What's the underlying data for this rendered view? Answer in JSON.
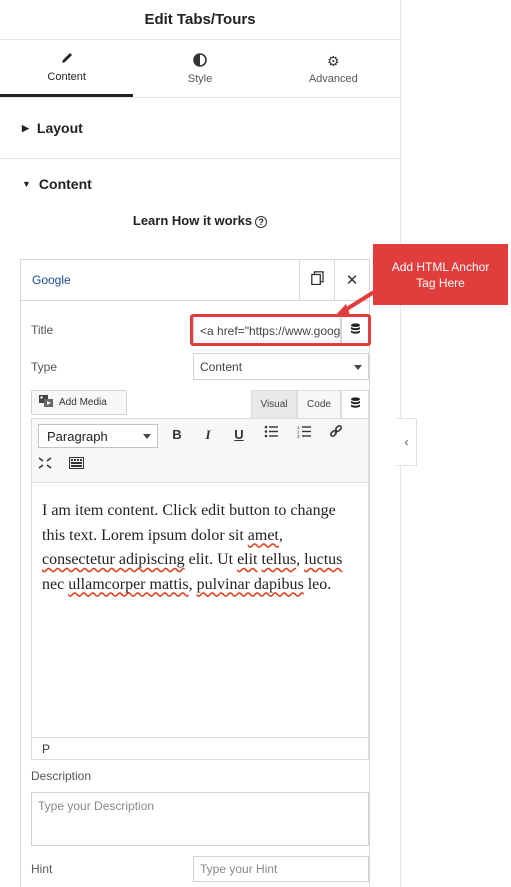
{
  "header": {
    "title": "Edit Tabs/Tours"
  },
  "tabs": [
    {
      "label": "Content",
      "icon": "pencil-icon",
      "active": true
    },
    {
      "label": "Style",
      "icon": "contrast-icon",
      "active": false
    },
    {
      "label": "Advanced",
      "icon": "gear-icon",
      "active": false
    }
  ],
  "sections": {
    "layout": "Layout",
    "content": "Content"
  },
  "learn": {
    "label": "Learn How it works"
  },
  "item": {
    "title": "Google",
    "fields": {
      "title_label": "Title",
      "title_value": "<a href=\"https://www.goog",
      "type_label": "Type",
      "type_value": "Content",
      "add_media": "Add Media",
      "visual_tab": "Visual",
      "code_tab": "Code",
      "format_value": "Paragraph",
      "content_p1": "I am item content. Click edit button to change this text. Lorem ipsum dolor sit ",
      "content_sq1": "amet",
      "content_p2": ", ",
      "content_sq2": "consectetur adipiscing",
      "content_p3": " elit. Ut ",
      "content_sq3": "elit",
      "content_sq4": "tellus",
      "content_p4": ", ",
      "content_sq5": "luctus",
      "content_p5": " nec ",
      "content_sq6": "ullamcorper mattis",
      "content_p6": ", ",
      "content_sq7": "pulvinar dapibus",
      "content_p7": " leo.",
      "status_path": "P",
      "description_label": "Description",
      "description_placeholder": "Type your Description",
      "hint_label": "Hint",
      "hint_placeholder": "Type your Hint"
    }
  },
  "callout": {
    "text": "Add HTML Anchor Tag Here",
    "color": "#e23d3d"
  }
}
